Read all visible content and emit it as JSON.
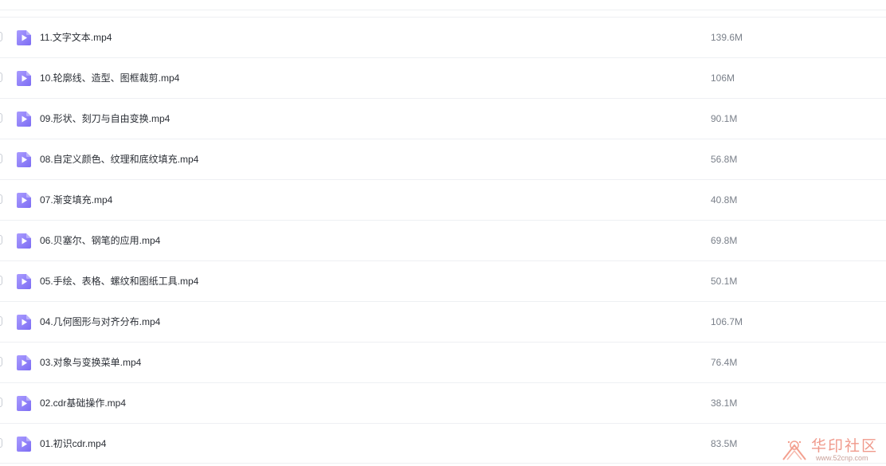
{
  "colors": {
    "icon_start": "#a99bff",
    "icon_end": "#7c6cf3",
    "divider": "#eef0f3",
    "name_text": "#2b2f36",
    "size_text": "#7a808a"
  },
  "files": [
    {
      "name": "11.文字文本.mp4",
      "size": "139.6M",
      "icon": "video-file-icon"
    },
    {
      "name": "10.轮廓线、造型、图框裁剪.mp4",
      "size": "106M",
      "icon": "video-file-icon"
    },
    {
      "name": "09.形状、刻刀与自由变换.mp4",
      "size": "90.1M",
      "icon": "video-file-icon"
    },
    {
      "name": "08.自定义颜色、纹理和底纹填充.mp4",
      "size": "56.8M",
      "icon": "video-file-icon"
    },
    {
      "name": "07.渐变填充.mp4",
      "size": "40.8M",
      "icon": "video-file-icon"
    },
    {
      "name": "06.贝塞尔、钢笔的应用.mp4",
      "size": "69.8M",
      "icon": "video-file-icon"
    },
    {
      "name": "05.手绘、表格、螺纹和图纸工具.mp4",
      "size": "50.1M",
      "icon": "video-file-icon"
    },
    {
      "name": "04.几何图形与对齐分布.mp4",
      "size": "106.7M",
      "icon": "video-file-icon"
    },
    {
      "name": "03.对象与变换菜单.mp4",
      "size": "76.4M",
      "icon": "video-file-icon"
    },
    {
      "name": "02.cdr基础操作.mp4",
      "size": "38.1M",
      "icon": "video-file-icon"
    },
    {
      "name": "01.初识cdr.mp4",
      "size": "83.5M",
      "icon": "video-file-icon"
    }
  ],
  "watermark": {
    "title": "华印社区",
    "url": "www.52cnp.com"
  }
}
